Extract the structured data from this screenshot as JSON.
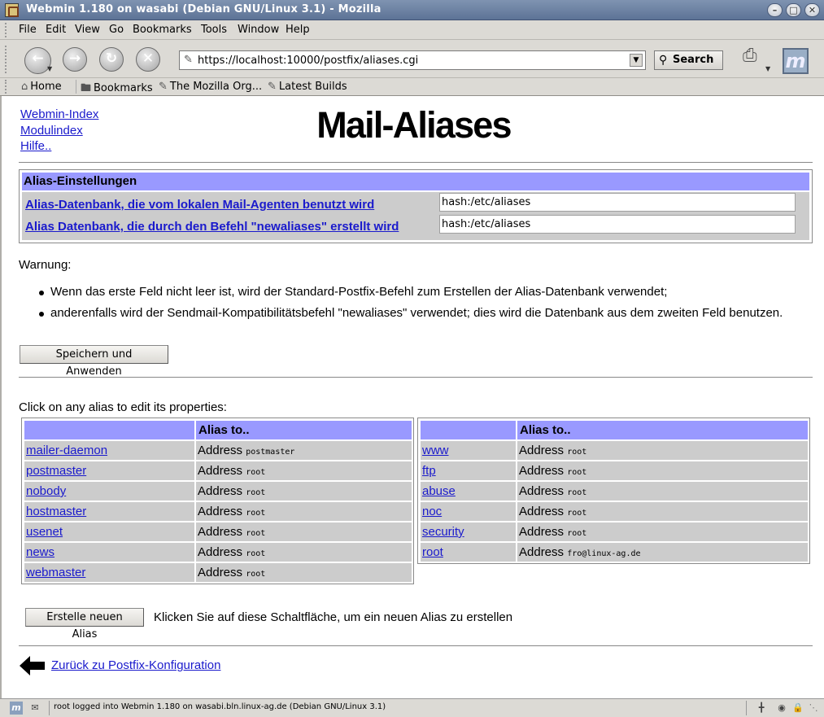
{
  "window": {
    "title": "Webmin 1.180 on wasabi (Debian GNU/Linux 3.1) - Mozilla",
    "minimize_symbol": "–",
    "maximize_symbol": "□",
    "close_symbol": "✕"
  },
  "menubar": {
    "items": [
      "File",
      "Edit",
      "View",
      "Go",
      "Bookmarks",
      "Tools",
      "Window",
      "Help"
    ]
  },
  "navbar": {
    "back_icon": "back-arrow-icon",
    "forward_icon": "forward-arrow-icon",
    "reload_icon": "reload-icon",
    "stop_icon": "stop-icon",
    "url": "https://localhost:10000/postfix/aliases.cgi",
    "search_label": "Search"
  },
  "bookmarks": {
    "items": [
      "Home",
      "Bookmarks",
      "The Mozilla Org...",
      "Latest Builds"
    ]
  },
  "page": {
    "links": [
      "Webmin-Index",
      "Modulindex",
      "Hilfe.."
    ],
    "title": "Mail-Aliases",
    "settings": {
      "header": "Alias-Einstellungen",
      "rows": [
        {
          "label": "Alias-Datenbank, die vom lokalen Mail-Agenten benutzt wird",
          "value": "hash:/etc/aliases"
        },
        {
          "label": "Alias Datenbank, die durch den Befehl \"newaliases\" erstellt wird",
          "value": "hash:/etc/aliases"
        }
      ]
    },
    "warning_label": "Warnung:",
    "warnings": [
      "Wenn das erste Feld nicht leer ist, wird der Standard-Postfix-Befehl zum Erstellen der Alias-Datenbank verwendet;",
      "anderenfalls wird der Sendmail-Kompatibilitätsbefehl \"newaliases\" verwendet; dies wird die Datenbank aus dem zweiten Feld benutzen."
    ],
    "save_button": "Speichern und Anwenden",
    "click_note": "Click on any alias to edit its properties:",
    "alias_header": "Alias to..",
    "address_prefix": "Address",
    "aliases_left": [
      {
        "name": "mailer-daemon",
        "target": "postmaster"
      },
      {
        "name": "postmaster",
        "target": "root"
      },
      {
        "name": "nobody",
        "target": "root"
      },
      {
        "name": "hostmaster",
        "target": "root"
      },
      {
        "name": "usenet",
        "target": "root"
      },
      {
        "name": "news",
        "target": "root"
      },
      {
        "name": "webmaster",
        "target": "root"
      }
    ],
    "aliases_right": [
      {
        "name": "www",
        "target": "root"
      },
      {
        "name": "ftp",
        "target": "root"
      },
      {
        "name": "abuse",
        "target": "root"
      },
      {
        "name": "noc",
        "target": "root"
      },
      {
        "name": "security",
        "target": "root"
      },
      {
        "name": "root",
        "target": "fro@linux-ag.de"
      }
    ],
    "new_alias_button": "Erstelle neuen Alias",
    "new_alias_note": "Klicken Sie auf diese Schaltfläche, um ein neuen Alias zu erstellen",
    "back_link": "Zurück zu Postfix-Konfiguration"
  },
  "statusbar": {
    "text": "root logged into Webmin 1.180 on wasabi.bln.linux-ag.de (Debian GNU/Linux 3.1)"
  }
}
